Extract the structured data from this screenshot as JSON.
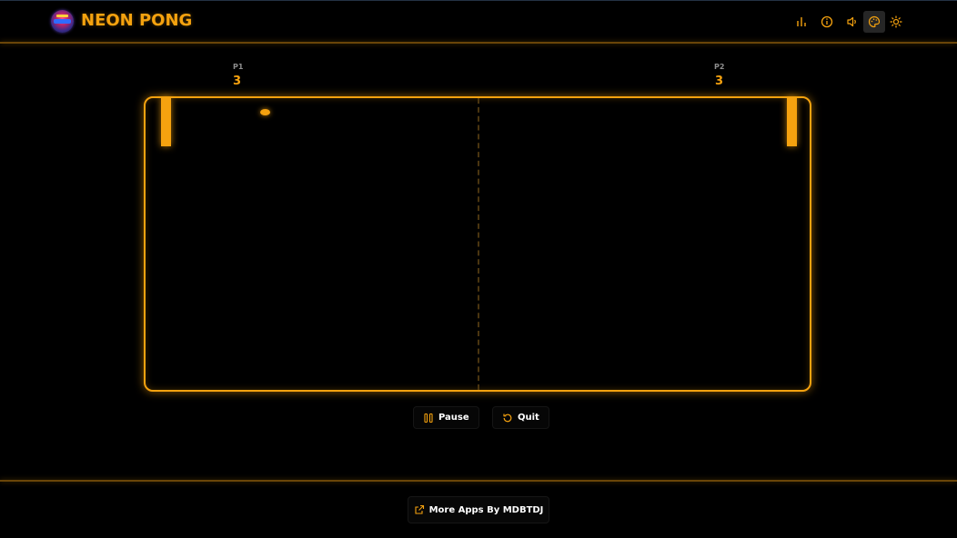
{
  "header": {
    "title": "NEON PONG",
    "icons": [
      "stats-icon",
      "info-icon",
      "volume-icon",
      "palette-icon",
      "theme-icon"
    ]
  },
  "scores": {
    "p1": {
      "label": "P1",
      "value": "3"
    },
    "p2": {
      "label": "P2",
      "value": "3"
    }
  },
  "controls": {
    "pause_label": "Pause",
    "quit_label": "Quit"
  },
  "footer": {
    "more_apps_label": "More Apps By MDBTDJ"
  },
  "colors": {
    "accent": "#f5a20f",
    "background": "#000000",
    "button_text": "#ffffff"
  }
}
